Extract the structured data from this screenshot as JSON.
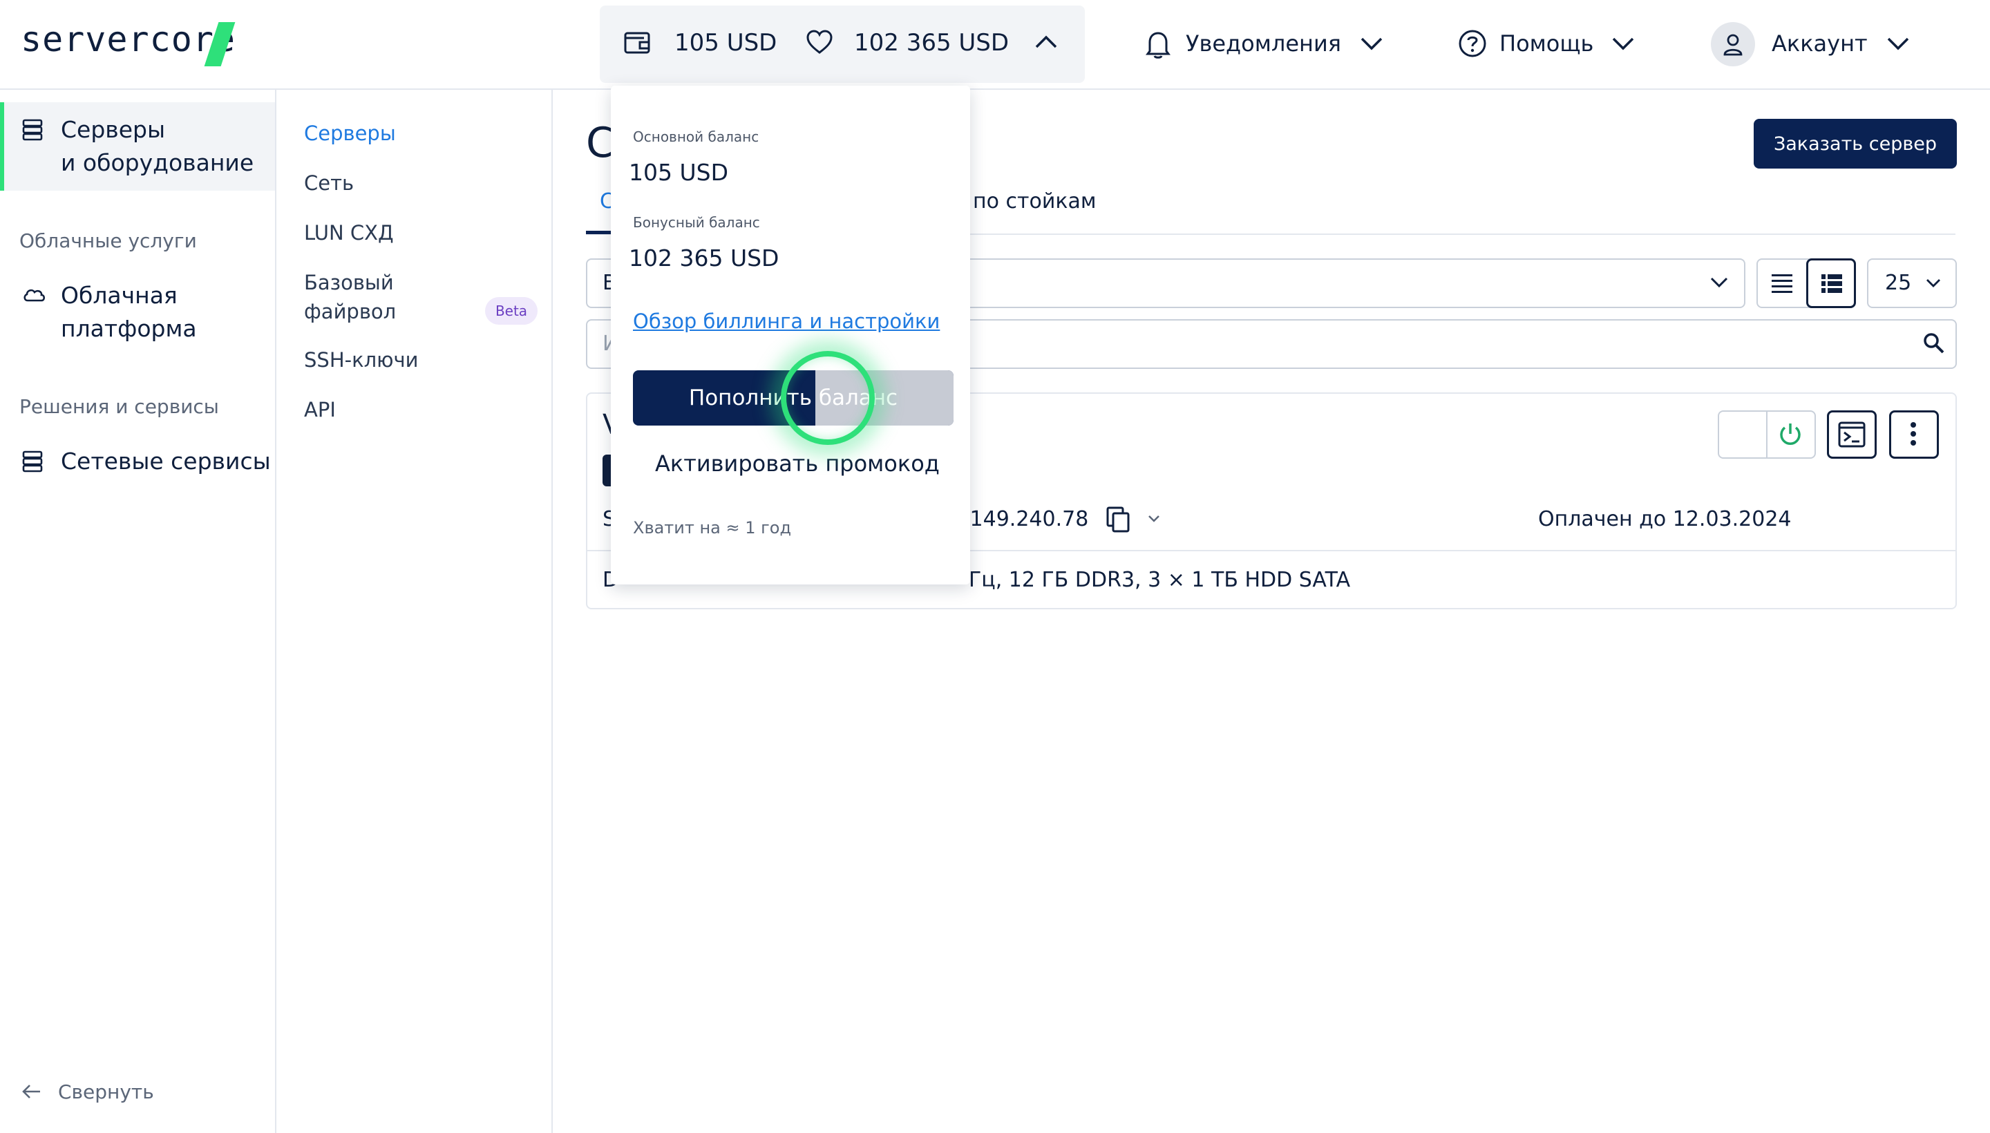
{
  "brand": {
    "logo": "servercore",
    "accent": "#2ee07a",
    "primary": "#0a2253"
  },
  "header": {
    "balance_main": "105 USD",
    "balance_bonus": "102 365 USD",
    "notifications": "Уведомления",
    "help": "Помощь",
    "account": "Аккаунт"
  },
  "sidebar": {
    "active_line1": "Серверы",
    "active_line2": "и оборудование",
    "section_cloud": "Облачные услуги",
    "cloud_line1": "Облачная",
    "cloud_line2": "платформа",
    "section_solutions": "Решения и сервисы",
    "network_services": "Сетевые сервисы",
    "collapse": "Свернуть"
  },
  "subnav": {
    "items": [
      "Серверы",
      "Сеть",
      "LUN СХД"
    ],
    "firewall_line1": "Базовый",
    "firewall_line2": "файрвол",
    "beta": "Beta",
    "ssh": "SSH-ключи",
    "api": "API"
  },
  "content": {
    "title_initial": "С",
    "tab_first_initial": "С",
    "tab_racks": "по стойкам",
    "filter_initial": "В",
    "search_initial": "И",
    "server_name_initial": "V",
    "ip_partial": ".149.240.78",
    "row_initial": "S",
    "paid_until": "Оплачен до 12.03.2024",
    "config_lead": "D",
    "config_partial": "Гц, 12 ГБ DDR3, 3 × 1 ТБ HDD SATA",
    "order_button": "Заказать сервер",
    "per_page": "25"
  },
  "dropdown": {
    "main_label": "Основной баланс",
    "main_value": "105 USD",
    "bonus_label": "Бонусный баланс",
    "bonus_value": "102 365 USD",
    "link": "Обзор биллинга и настройки",
    "topup_button": "Пополнить баланс",
    "promo_button": "Активировать промокод",
    "footnote": "Хватит на ≈ 1 год"
  }
}
